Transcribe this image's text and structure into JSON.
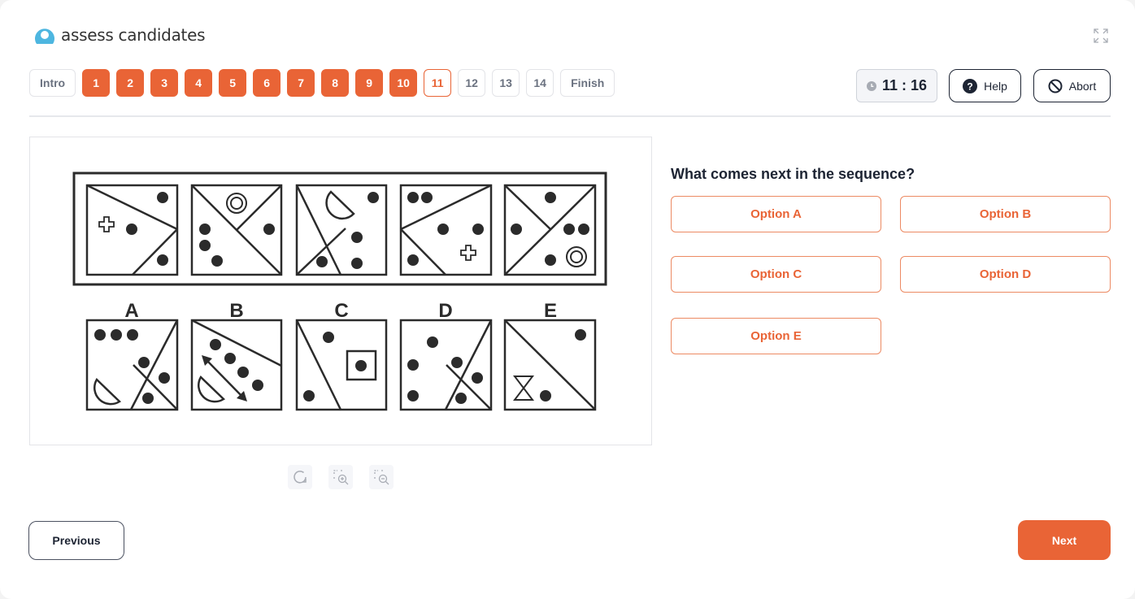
{
  "brand": {
    "name": "assess candidates",
    "logo_color": "#4db6e0",
    "accent": "#e96436"
  },
  "nav": {
    "items": [
      {
        "label": "Intro",
        "state": "pending"
      },
      {
        "label": "1",
        "state": "done"
      },
      {
        "label": "2",
        "state": "done"
      },
      {
        "label": "3",
        "state": "done"
      },
      {
        "label": "4",
        "state": "done"
      },
      {
        "label": "5",
        "state": "done"
      },
      {
        "label": "6",
        "state": "done"
      },
      {
        "label": "7",
        "state": "done"
      },
      {
        "label": "8",
        "state": "done"
      },
      {
        "label": "9",
        "state": "done"
      },
      {
        "label": "10",
        "state": "done"
      },
      {
        "label": "11",
        "state": "current"
      },
      {
        "label": "12",
        "state": "pending"
      },
      {
        "label": "13",
        "state": "pending"
      },
      {
        "label": "14",
        "state": "pending"
      },
      {
        "label": "Finish",
        "state": "pending"
      }
    ]
  },
  "header": {
    "timer": "11 : 16",
    "help_label": "Help",
    "abort_label": "Abort",
    "icons": {
      "timer": "clock-icon",
      "help": "question-circle-icon",
      "abort": "ban-icon",
      "expand": "fullscreen-expand-icon"
    }
  },
  "puzzle": {
    "answer_labels": [
      "A",
      "B",
      "C",
      "D",
      "E"
    ]
  },
  "image_tools": [
    {
      "name": "reset",
      "icon": "reset-icon"
    },
    {
      "name": "zoom-in",
      "icon": "zoom-in-icon"
    },
    {
      "name": "zoom-out",
      "icon": "zoom-out-icon"
    }
  ],
  "question": {
    "text": "What comes next in the sequence?",
    "options": [
      "Option A",
      "Option B",
      "Option C",
      "Option D",
      "Option E"
    ]
  },
  "footer": {
    "previous_label": "Previous",
    "next_label": "Next"
  }
}
